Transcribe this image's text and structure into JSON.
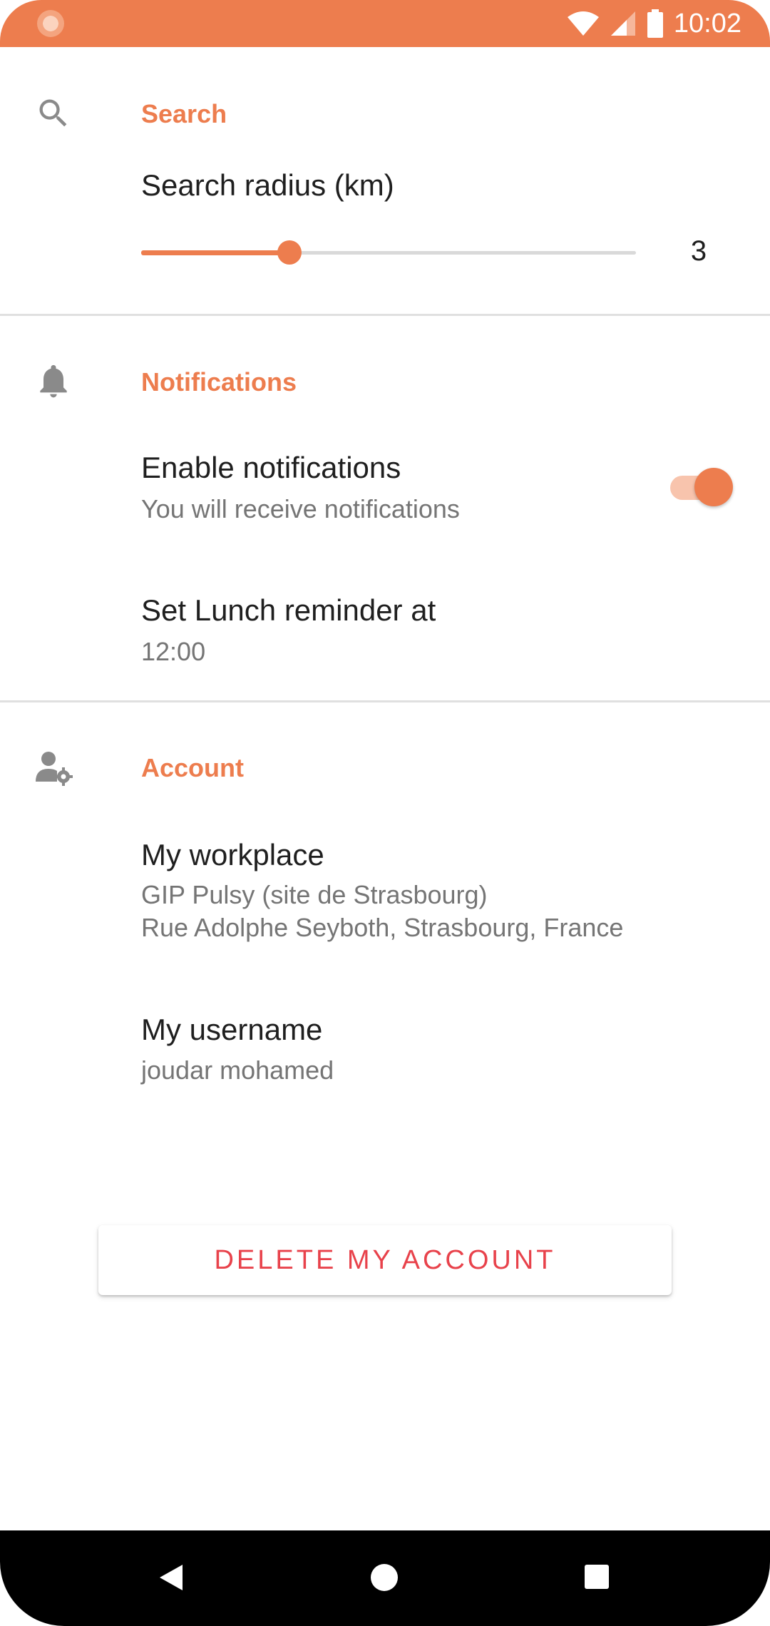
{
  "status_bar": {
    "time": "10:02",
    "color": "#ED7D4E",
    "icons": [
      "wifi-icon",
      "signal-icon",
      "battery-icon"
    ]
  },
  "search": {
    "icon": "search-icon",
    "section_title": "Search",
    "radius_label": "Search radius (km)",
    "radius_value": "3",
    "slider_fraction": 0.3
  },
  "notifications": {
    "icon": "bell-icon",
    "section_title": "Notifications",
    "enable_title": "Enable notifications",
    "enable_sub": "You will receive notifications",
    "enabled": true,
    "reminder_title": "Set Lunch reminder at",
    "reminder_value": "12:00"
  },
  "account": {
    "icon": "account-settings-icon",
    "section_title": "Account",
    "workplace_title": "My workplace",
    "workplace_line1": "GIP Pulsy (site de Strasbourg)",
    "workplace_line2": "Rue Adolphe Seyboth, Strasbourg, France",
    "username_title": "My username",
    "username_value": "joudar mohamed",
    "delete_label": "DELETE MY ACCOUNT"
  },
  "colors": {
    "accent": "#ED7D4E",
    "danger": "#E8424B"
  },
  "nav_bar": {
    "icons": [
      "back-icon",
      "home-icon",
      "recents-icon"
    ]
  }
}
